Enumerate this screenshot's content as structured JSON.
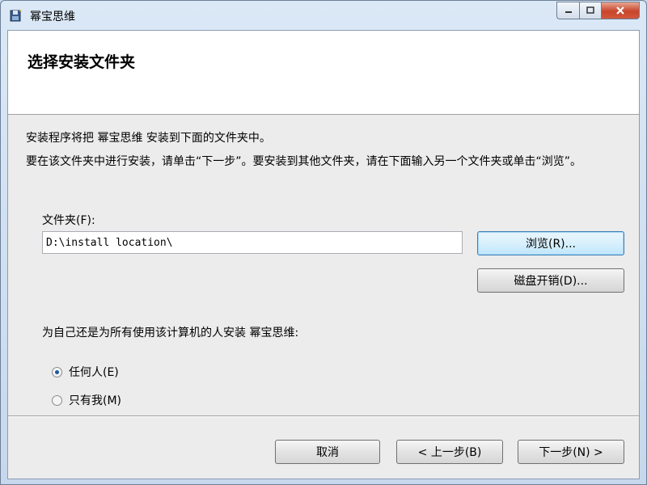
{
  "window": {
    "title": "幂宝思维",
    "icon": "installer-disk-icon"
  },
  "header": {
    "title": "选择安装文件夹"
  },
  "body": {
    "line1": "安装程序将把 幂宝思维 安装到下面的文件夹中。",
    "line2": "要在该文件夹中进行安装，请单击“下一步”。要安装到其他文件夹，请在下面输入另一个文件夹或单击“浏览”。",
    "folder_label": "文件夹(F):",
    "folder_value": "D:\\install location\\",
    "browse_label": "浏览(R)...",
    "disk_cost_label": "磁盘开销(D)...",
    "install_for_label": "为自己还是为所有使用该计算机的人安装 幂宝思维:",
    "options": [
      {
        "label": "任何人(E)",
        "checked": true
      },
      {
        "label": "只有我(M)",
        "checked": false
      }
    ]
  },
  "footer": {
    "cancel_label": "取消",
    "back_label": "< 上一步(B)",
    "next_label": "下一步(N) >"
  }
}
